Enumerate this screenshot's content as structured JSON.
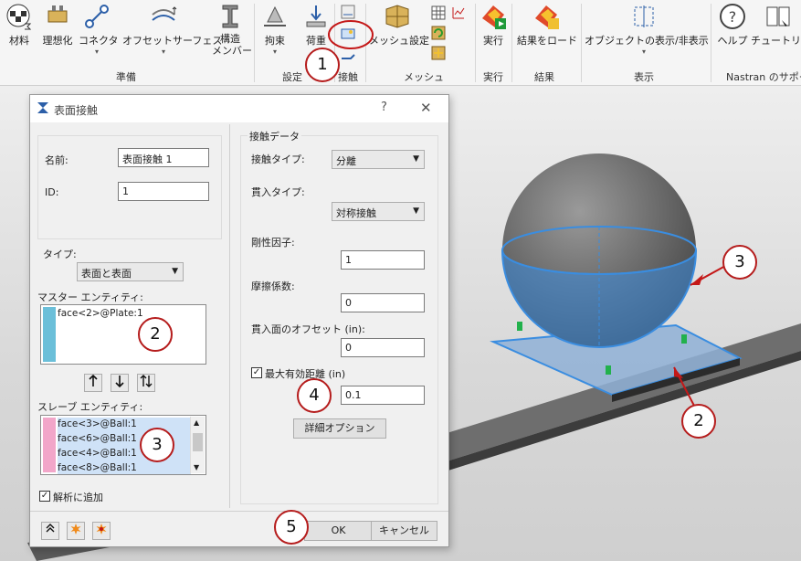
{
  "ribbon": {
    "items": [
      {
        "key": "material",
        "label": "材料"
      },
      {
        "key": "idealize",
        "label": "理想化"
      },
      {
        "key": "connector",
        "label": "コネクタ"
      },
      {
        "key": "offset",
        "label": "オフセットサーフェス"
      },
      {
        "key": "structural",
        "label": "構造\nメンバー"
      },
      {
        "key": "constraint",
        "label": "拘束"
      },
      {
        "key": "load",
        "label": "荷重"
      },
      {
        "key": "mesh",
        "label": "メッシュ設定"
      },
      {
        "key": "run",
        "label": "実行"
      },
      {
        "key": "load_results",
        "label": "結果をロード"
      },
      {
        "key": "showhide",
        "label": "オブジェクトの表示/非表示"
      },
      {
        "key": "help",
        "label": "ヘルプ"
      },
      {
        "key": "tutorial",
        "label": "チュートリアル"
      }
    ],
    "groups": {
      "prepare": "準備",
      "setup": "設定",
      "contact": "接触",
      "mesh": "メッシュ",
      "run": "実行",
      "results": "結果",
      "display": "表示",
      "nastran": "Nastran のサポー"
    }
  },
  "dialog": {
    "title": "表面接触",
    "help": "?",
    "close": "✕",
    "name_label": "名前:",
    "name_value": "表面接触 1",
    "id_label": "ID:",
    "id_value": "1",
    "type_label": "タイプ:",
    "type_value": "表面と表面",
    "master_label": "マスター エンティティ:",
    "master_items": [
      "face<2>@Plate:1"
    ],
    "slave_label": "スレーブ エンティティ:",
    "slave_items": [
      "face<3>@Ball:1",
      "face<6>@Ball:1",
      "face<4>@Ball:1",
      "face<8>@Ball:1"
    ],
    "add_to_analysis": "解析に追加",
    "contact_data_legend": "接触データ",
    "contact_type_label": "接触タイプ:",
    "contact_type_value": "分離",
    "penetration_type_label": "貫入タイプ:",
    "penetration_type_value": "対称接触",
    "stiffness_label": "剛性因子:",
    "stiffness_value": "1",
    "friction_label": "摩擦係数:",
    "friction_value": "0",
    "offset_label": "貫入面のオフセット (in):",
    "offset_value": "0",
    "max_dist_label": "最大有効距離 (in)",
    "max_dist_value": "0.1",
    "advanced_button": "詳細オプション",
    "ok": "OK",
    "cancel": "キャンセル"
  },
  "callouts": [
    "1",
    "2",
    "3",
    "4",
    "5",
    "3",
    "2"
  ],
  "colors": {
    "callout_border": "#b51c1c",
    "master_swatch": "#6bbfd9",
    "slave_swatch": "#f2a6c9",
    "selection_blue": "#3a8de0",
    "arrow_red": "#c41818"
  }
}
